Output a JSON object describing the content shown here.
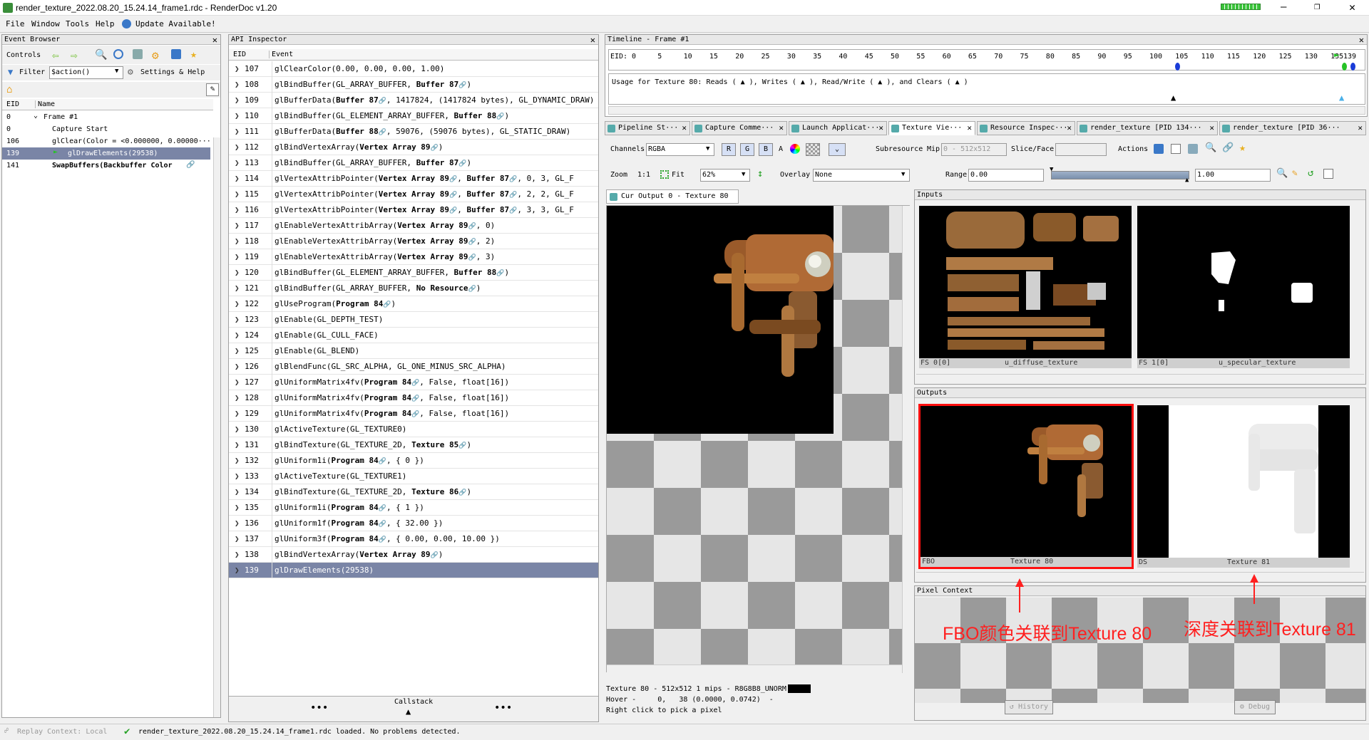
{
  "window": {
    "title": "render_texture_2022.08.20_15.24.14_frame1.rdc - RenderDoc v1.20"
  },
  "menu": [
    "File",
    "Window",
    "Tools",
    "Help"
  ],
  "update": "Update Available!",
  "event_browser": {
    "title": "Event Browser",
    "controls": "Controls",
    "filter_label": "Filter",
    "filter_value": "$action()",
    "settings": "Settings & Help",
    "col_eid": "EID",
    "col_name": "Name",
    "rows": [
      {
        "eid": "0",
        "name": "Frame #1"
      },
      {
        "eid": "0",
        "name": "Capture Start"
      },
      {
        "eid": "106",
        "name": "glClear(Color = <0.000000, 0.00000···"
      },
      {
        "eid": "139",
        "name": "glDrawElements(29538)"
      },
      {
        "eid": "141",
        "name": "SwapBuffers(Backbuffer Color"
      }
    ]
  },
  "api_inspector": {
    "title": "API Inspector",
    "col_eid": "EID",
    "col_event": "Event",
    "callstack": "Callstack",
    "rows": [
      {
        "eid": "107",
        "text": "glClearColor(0.00, 0.00, 0.00, 1.00)"
      },
      {
        "eid": "108",
        "text": "glBindBuffer(GL_ARRAY_BUFFER, Buffer 87)"
      },
      {
        "eid": "109",
        "text": "glBufferData(Buffer 87, 1417824, (1417824 bytes), GL_DYNAMIC_DRAW)"
      },
      {
        "eid": "110",
        "text": "glBindBuffer(GL_ELEMENT_ARRAY_BUFFER, Buffer 88)"
      },
      {
        "eid": "111",
        "text": "glBufferData(Buffer 88, 59076, (59076 bytes), GL_STATIC_DRAW)"
      },
      {
        "eid": "112",
        "text": "glBindVertexArray(Vertex Array 89)"
      },
      {
        "eid": "113",
        "text": "glBindBuffer(GL_ARRAY_BUFFER, Buffer 87)"
      },
      {
        "eid": "114",
        "text": "glVertexAttribPointer(Vertex Array 89, Buffer 87, 0, 3, GL_F"
      },
      {
        "eid": "115",
        "text": "glVertexAttribPointer(Vertex Array 89, Buffer 87, 2, 2, GL_F"
      },
      {
        "eid": "116",
        "text": "glVertexAttribPointer(Vertex Array 89, Buffer 87, 3, 3, GL_F"
      },
      {
        "eid": "117",
        "text": "glEnableVertexAttribArray(Vertex Array 89, 0)"
      },
      {
        "eid": "118",
        "text": "glEnableVertexAttribArray(Vertex Array 89, 2)"
      },
      {
        "eid": "119",
        "text": "glEnableVertexAttribArray(Vertex Array 89, 3)"
      },
      {
        "eid": "120",
        "text": "glBindBuffer(GL_ELEMENT_ARRAY_BUFFER, Buffer 88)"
      },
      {
        "eid": "121",
        "text": "glBindBuffer(GL_ARRAY_BUFFER, No Resource)"
      },
      {
        "eid": "122",
        "text": "glUseProgram(Program 84)"
      },
      {
        "eid": "123",
        "text": "glEnable(GL_DEPTH_TEST)"
      },
      {
        "eid": "124",
        "text": "glEnable(GL_CULL_FACE)"
      },
      {
        "eid": "125",
        "text": "glEnable(GL_BLEND)"
      },
      {
        "eid": "126",
        "text": "glBlendFunc(GL_SRC_ALPHA, GL_ONE_MINUS_SRC_ALPHA)"
      },
      {
        "eid": "127",
        "text": "glUniformMatrix4fv(Program 84, False, float[16])"
      },
      {
        "eid": "128",
        "text": "glUniformMatrix4fv(Program 84, False, float[16])"
      },
      {
        "eid": "129",
        "text": "glUniformMatrix4fv(Program 84, False, float[16])"
      },
      {
        "eid": "130",
        "text": "glActiveTexture(GL_TEXTURE0)"
      },
      {
        "eid": "131",
        "text": "glBindTexture(GL_TEXTURE_2D, Texture 85)"
      },
      {
        "eid": "132",
        "text": "glUniform1i(Program 84, { 0 })"
      },
      {
        "eid": "133",
        "text": "glActiveTexture(GL_TEXTURE1)"
      },
      {
        "eid": "134",
        "text": "glBindTexture(GL_TEXTURE_2D, Texture 86)"
      },
      {
        "eid": "135",
        "text": "glUniform1i(Program 84, { 1 })"
      },
      {
        "eid": "136",
        "text": "glUniform1f(Program 84, { 32.00 })"
      },
      {
        "eid": "137",
        "text": "glUniform3f(Program 84, { 0.00, 0.00, 10.00 })"
      },
      {
        "eid": "138",
        "text": "glBindVertexArray(Vertex Array 89)"
      },
      {
        "eid": "139",
        "text": "glDrawElements(29538)"
      }
    ]
  },
  "timeline": {
    "title": "Timeline - Frame #1",
    "eid_label": "EID:",
    "ticks": [
      "0",
      "5",
      "10",
      "15",
      "20",
      "25",
      "30",
      "35",
      "40",
      "45",
      "50",
      "55",
      "60",
      "65",
      "70",
      "75",
      "80",
      "85",
      "90",
      "95",
      "100",
      "105",
      "110",
      "115",
      "120",
      "125",
      "130",
      "135",
      "139"
    ],
    "usage": "Usage for Texture 80: Reads ( ▲ ), Writes ( ▲ ), Read/Write ( ▲ ), and Clears ( ▲ )"
  },
  "tabs": [
    "Pipeline St···",
    "Capture Comme···",
    "Launch Applicat···",
    "Texture Vie···",
    "Resource Inspec···",
    "render_texture [PID 134···",
    "render_texture [PID 36···"
  ],
  "texture_viewer": {
    "channels_label": "Channels",
    "channels_value": "RGBA",
    "rgb": [
      "R",
      "G",
      "B"
    ],
    "alpha": "A",
    "subresource": "Subresource",
    "mip_label": "Mip",
    "mip_value": "0 - 512x512",
    "slice_label": "Slice/Face",
    "actions": "Actions",
    "zoom_label": "Zoom",
    "zoom_11": "1:1",
    "fit": "Fit",
    "zoom_value": "62%",
    "overlay_label": "Overlay",
    "overlay_value": "None",
    "range_label": "Range",
    "range_min": "0.00",
    "range_max": "1.00",
    "cur_output": "Cur Output 0 - Texture 80",
    "status_line1": "Texture 80 - 512x512 1 mips - R8G8B8_UNORM",
    "status_line2": "Hover -     0,   38 (0.0000, 0.0742)  -",
    "status_line3": "Right click to pick a pixel"
  },
  "inputs": {
    "title": "Inputs",
    "items": [
      {
        "slot": "FS 0[0]",
        "name": "u_diffuse_texture"
      },
      {
        "slot": "FS 1[0]",
        "name": "u_specular_texture"
      }
    ]
  },
  "outputs": {
    "title": "Outputs",
    "items": [
      {
        "slot": "FBO",
        "name": "Texture 80"
      },
      {
        "slot": "DS",
        "name": "Texture 81"
      }
    ]
  },
  "pixel_context": {
    "title": "Pixel Context",
    "history": "History",
    "debug": "Debug"
  },
  "annotations": {
    "left": "FBO颜色关联到Texture 80",
    "right": "深度关联到Texture 81"
  },
  "statusbar": {
    "replay": "Replay Context: Local",
    "message": "render_texture_2022.08.20_15.24.14_frame1.rdc loaded. No problems detected."
  },
  "colors": {
    "selection": "#7a85a6",
    "annotation": "#ff2020",
    "accent_green": "#27c227"
  }
}
